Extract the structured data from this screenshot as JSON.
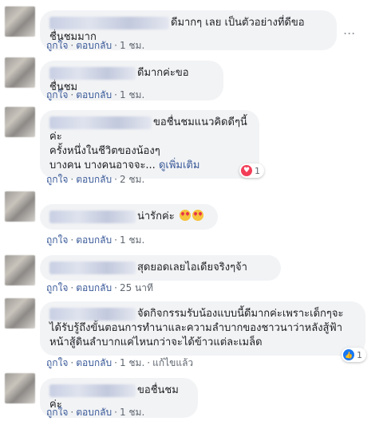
{
  "actions": {
    "like": "ถูกใจ",
    "reply": "ตอบกลับ",
    "dot": "·",
    "edited": "แก้ไขแล้ว"
  },
  "comments": [
    {
      "text": "ดีมากๆ เลย เป็นตัวอย่างที่ดีขอชื่นชมมาก",
      "time": "1 ชม."
    },
    {
      "text": "ดีมากค่ะขอชื่นชม",
      "time": "1 ชม."
    },
    {
      "text": "ขอชื่นชมแนวคิดดีๆนี้ค่ะ",
      "text2": "ครั้งหนึ่งในชีวิตของน้องๆ",
      "text3": "บางคน บางคนอาจจะ...",
      "more": "ดูเพิ่มเติม",
      "time": "2 ชม.",
      "reaction_count": "1"
    },
    {
      "text": "น่ารักค่ะ",
      "time": "1 ชม."
    },
    {
      "text": "สุดยอดเลยไอเดียจริงๆจ้า",
      "time": "25 นาที"
    },
    {
      "text": "จัดกิจกรรมรับน้องแบบนี้ดีมากค่ะเพราะเด็กๆจะ",
      "text2": "ได้รับรู้ถึงขั้นตอนการทำนาและความลำบากของชาวนาว่าหลังสู้ฟ้า",
      "text3": "หน้าสู้ดินลำบากแค่ไหนกว่าจะได้ข้าวแต่ละเมล็ด",
      "time": "1 ชม.",
      "reaction_count": "1"
    },
    {
      "text": "ขอชื่นชมค่ะ",
      "time": "1 ชม."
    }
  ],
  "ellipsis": "...",
  "icons": {
    "heart": "heart-reaction-icon",
    "like": "like-reaction-icon",
    "emoji": "heart-eyes-emoji-icon",
    "more": "more-options-icon"
  }
}
